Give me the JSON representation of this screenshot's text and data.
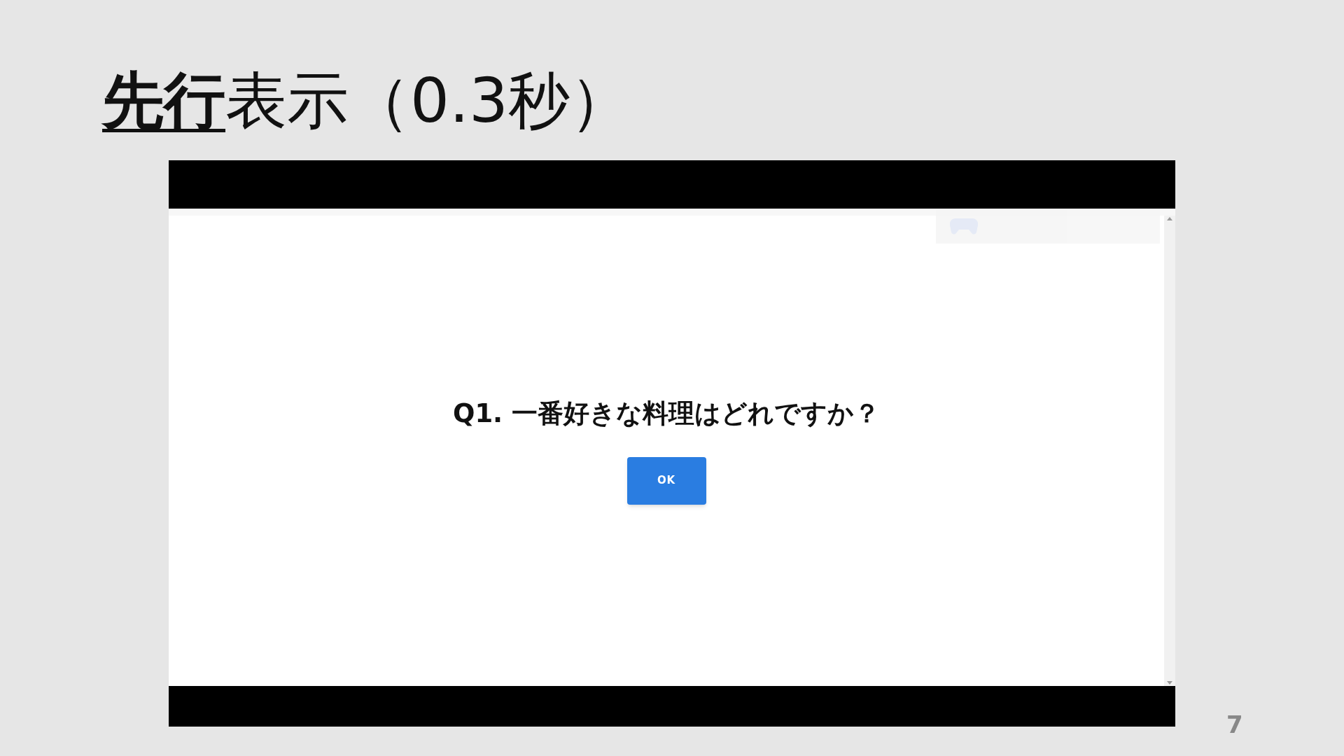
{
  "slide": {
    "title": {
      "emphasis": "先行",
      "rest": "表示（0.3秒）"
    },
    "page_number": "7"
  },
  "video": {
    "question": "Q1. 一番好きな料理はどれですか？",
    "button": "OK"
  }
}
